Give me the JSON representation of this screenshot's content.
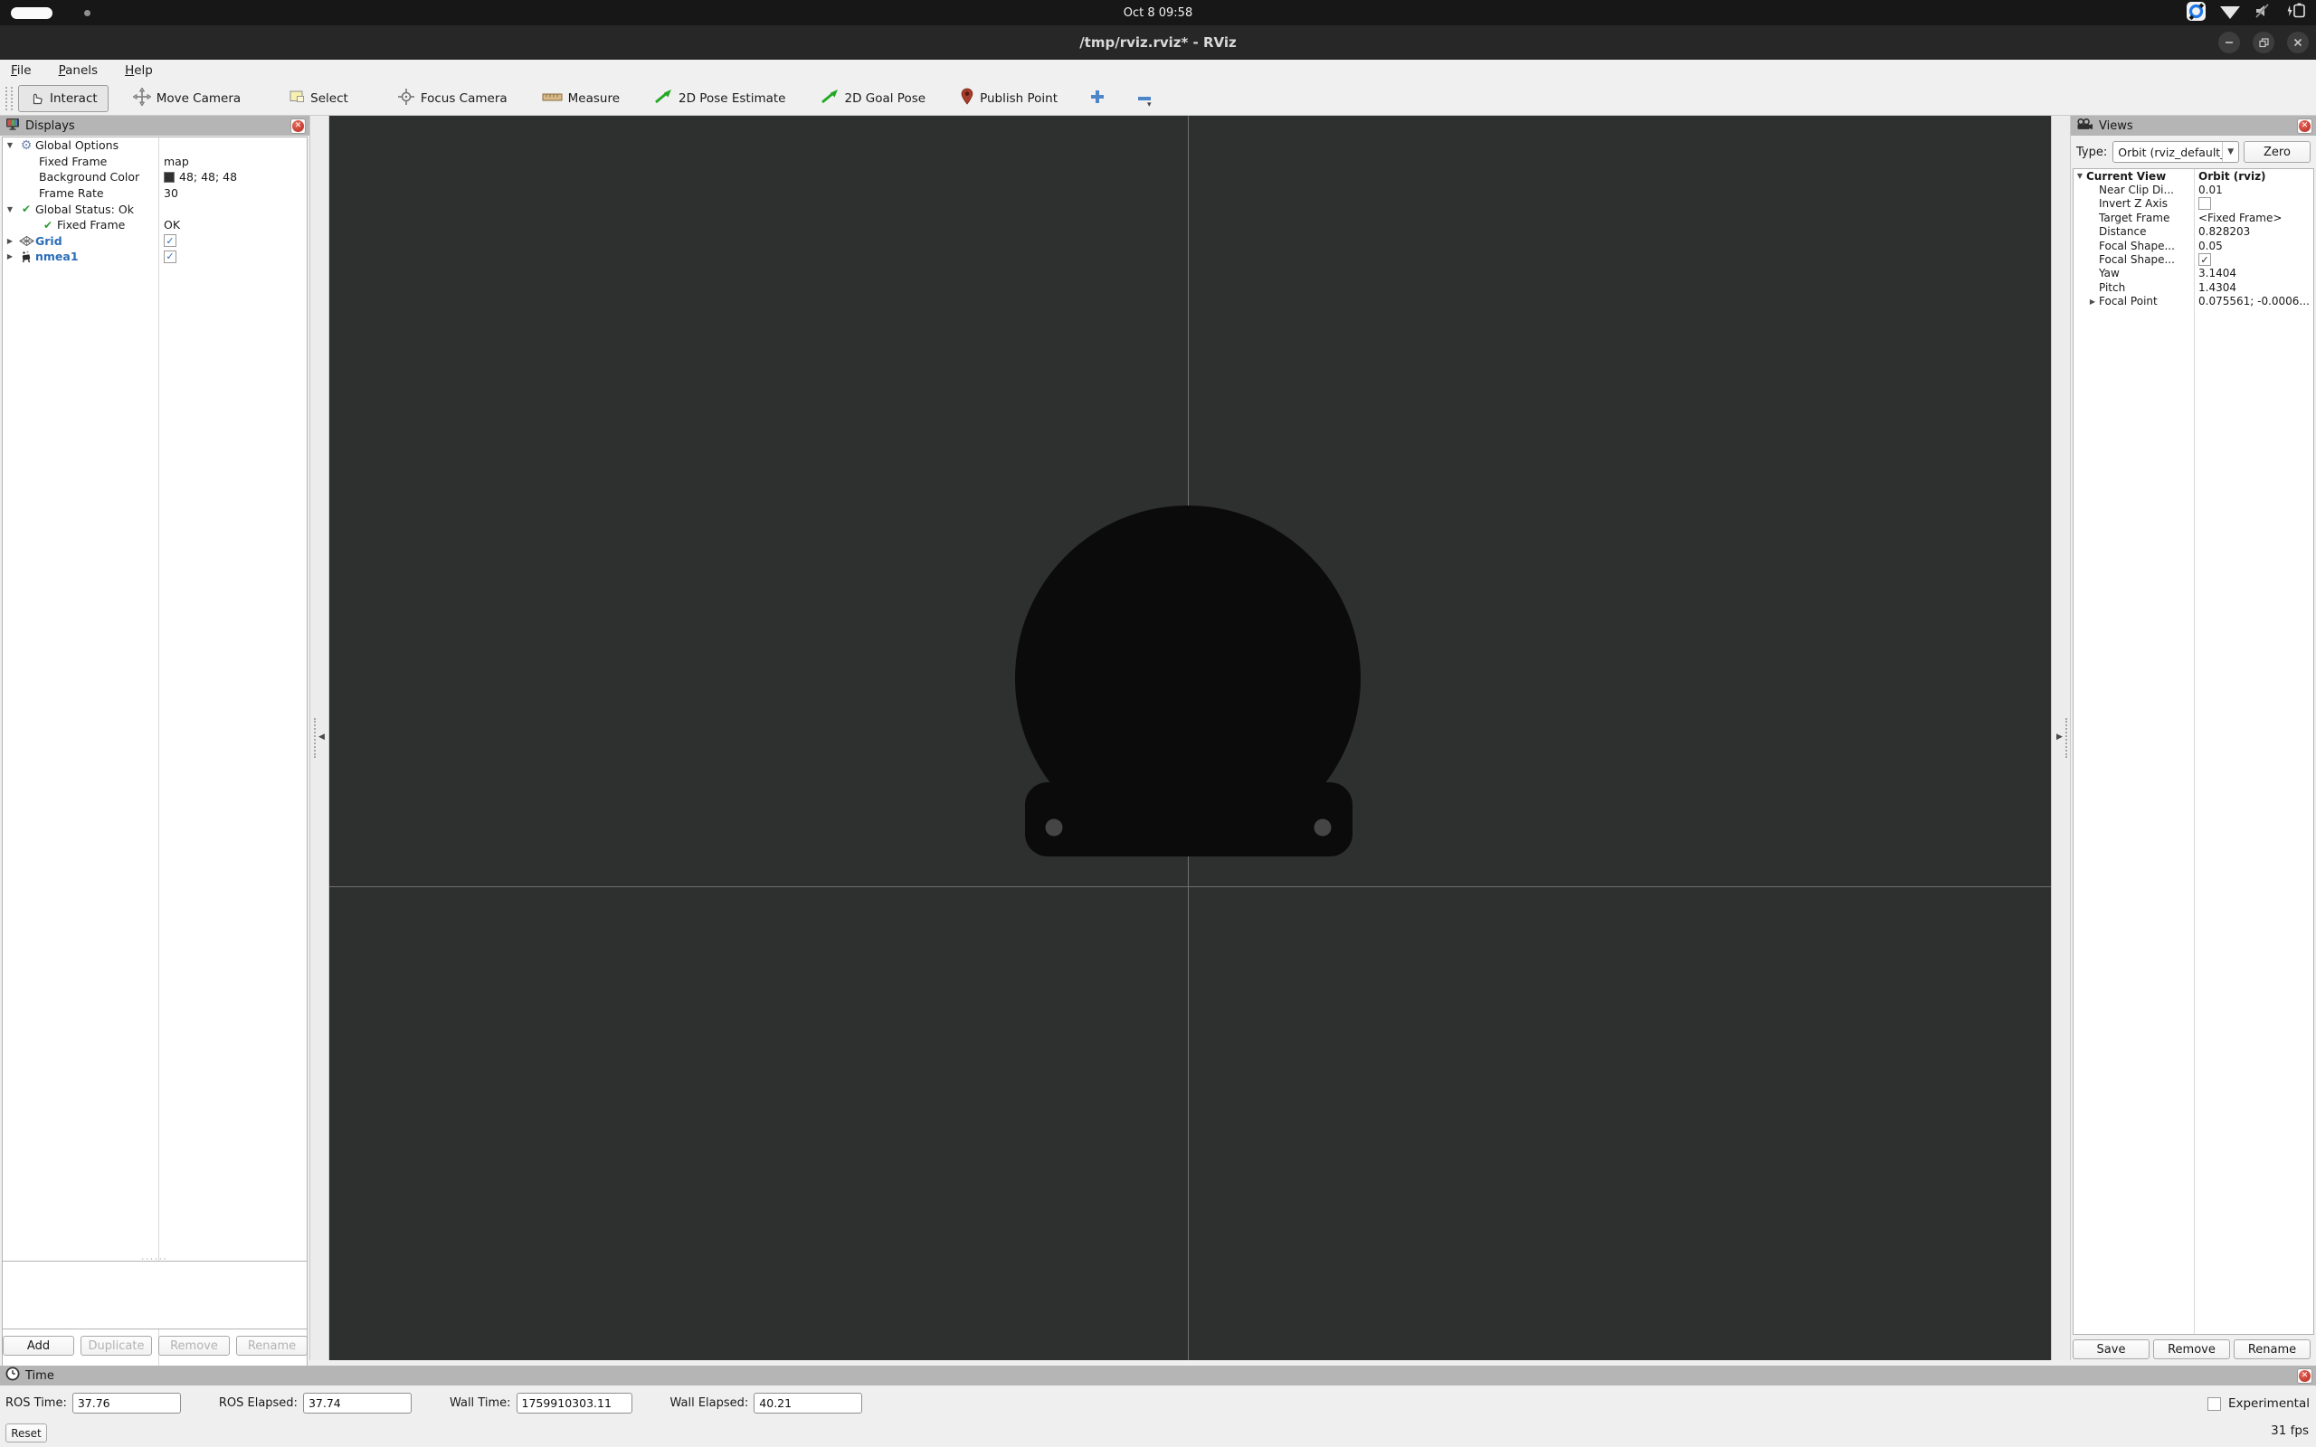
{
  "system_bar": {
    "clock": "Oct 8 09:58"
  },
  "window": {
    "title": "/tmp/rviz.rviz* - RViz"
  },
  "menu": {
    "items": [
      {
        "label": "File"
      },
      {
        "label": "Panels"
      },
      {
        "label": "Help"
      }
    ]
  },
  "toolbar": {
    "tools": [
      {
        "label": "Interact",
        "selected": true
      },
      {
        "label": "Move Camera"
      },
      {
        "label": "Select"
      },
      {
        "label": "Focus Camera"
      },
      {
        "label": "Measure"
      },
      {
        "label": "2D Pose Estimate"
      },
      {
        "label": "2D Goal Pose"
      },
      {
        "label": "Publish Point"
      }
    ]
  },
  "displays_panel": {
    "title": "Displays",
    "rows": [
      {
        "label": "Global Options",
        "value": ""
      },
      {
        "label": "Fixed Frame",
        "value": "map"
      },
      {
        "label": "Background Color",
        "value": "48; 48; 48"
      },
      {
        "label": "Frame Rate",
        "value": "30"
      },
      {
        "label": "Global Status: Ok",
        "value": ""
      },
      {
        "label": "Fixed Frame",
        "value": "OK"
      },
      {
        "label": "Grid",
        "checked": true
      },
      {
        "label": "nmea1",
        "checked": true
      }
    ],
    "checkmark": "✓",
    "buttons": [
      {
        "label": "Add",
        "enabled": true
      },
      {
        "label": "Duplicate",
        "enabled": false
      },
      {
        "label": "Remove",
        "enabled": false
      },
      {
        "label": "Rename",
        "enabled": false
      }
    ]
  },
  "views_panel": {
    "title": "Views",
    "type_label": "Type:",
    "type_value": "Orbit (rviz_default_",
    "zero_button": "Zero",
    "rows": [
      {
        "label": "Current View",
        "value": "Orbit (rviz)"
      },
      {
        "label": "Near Clip Di...",
        "value": "0.01"
      },
      {
        "label": "Invert Z Axis",
        "value": ""
      },
      {
        "label": "Target Frame",
        "value": "<Fixed Frame>"
      },
      {
        "label": "Distance",
        "value": "0.828203"
      },
      {
        "label": "Focal Shape...",
        "value": "0.05"
      },
      {
        "label": "Focal Shape...",
        "value": ""
      },
      {
        "label": "Yaw",
        "value": "3.1404"
      },
      {
        "label": "Pitch",
        "value": "1.4304"
      },
      {
        "label": "Focal Point",
        "value": "0.075561; -0.0006..."
      }
    ],
    "checkmark": "✓",
    "buttons": [
      {
        "label": "Save"
      },
      {
        "label": "Remove"
      },
      {
        "label": "Rename"
      }
    ]
  },
  "time_panel": {
    "title": "Time",
    "fields": [
      {
        "label": "ROS Time:",
        "value": "37.76"
      },
      {
        "label": "ROS Elapsed:",
        "value": "37.74"
      },
      {
        "label": "Wall Time:",
        "value": "1759910303.11"
      },
      {
        "label": "Wall Elapsed:",
        "value": "40.21"
      }
    ],
    "experimental_label": "Experimental",
    "reset_button": "Reset",
    "fps": "31 fps"
  },
  "colors": {
    "viewport_background": "#303030",
    "display_name_blue": "#2a6db8",
    "status_green": "#2f9b35",
    "robot_black": "#0b0b0b"
  }
}
